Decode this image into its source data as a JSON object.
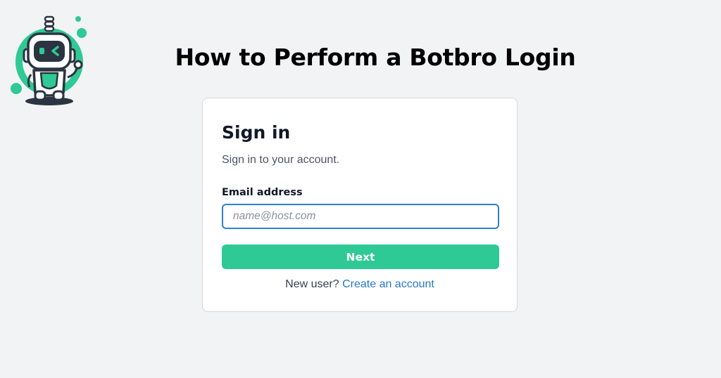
{
  "header": {
    "title": "How to Perform a Botbro Login"
  },
  "logo": {
    "icon": "robot-mascot-icon",
    "accent_color": "#2ec994",
    "dark_color": "#2b3440"
  },
  "signin": {
    "title": "Sign in",
    "subtitle": "Sign in to your account.",
    "email_label": "Email address",
    "email_value": "",
    "email_placeholder": "name@host.com",
    "next_label": "Next",
    "new_user_text": "New user?",
    "create_account_label": "Create an account"
  },
  "colors": {
    "background": "#f2f3f5",
    "button": "#2ec994",
    "link": "#2878c8",
    "input_focus_border": "#2f7fd0"
  }
}
